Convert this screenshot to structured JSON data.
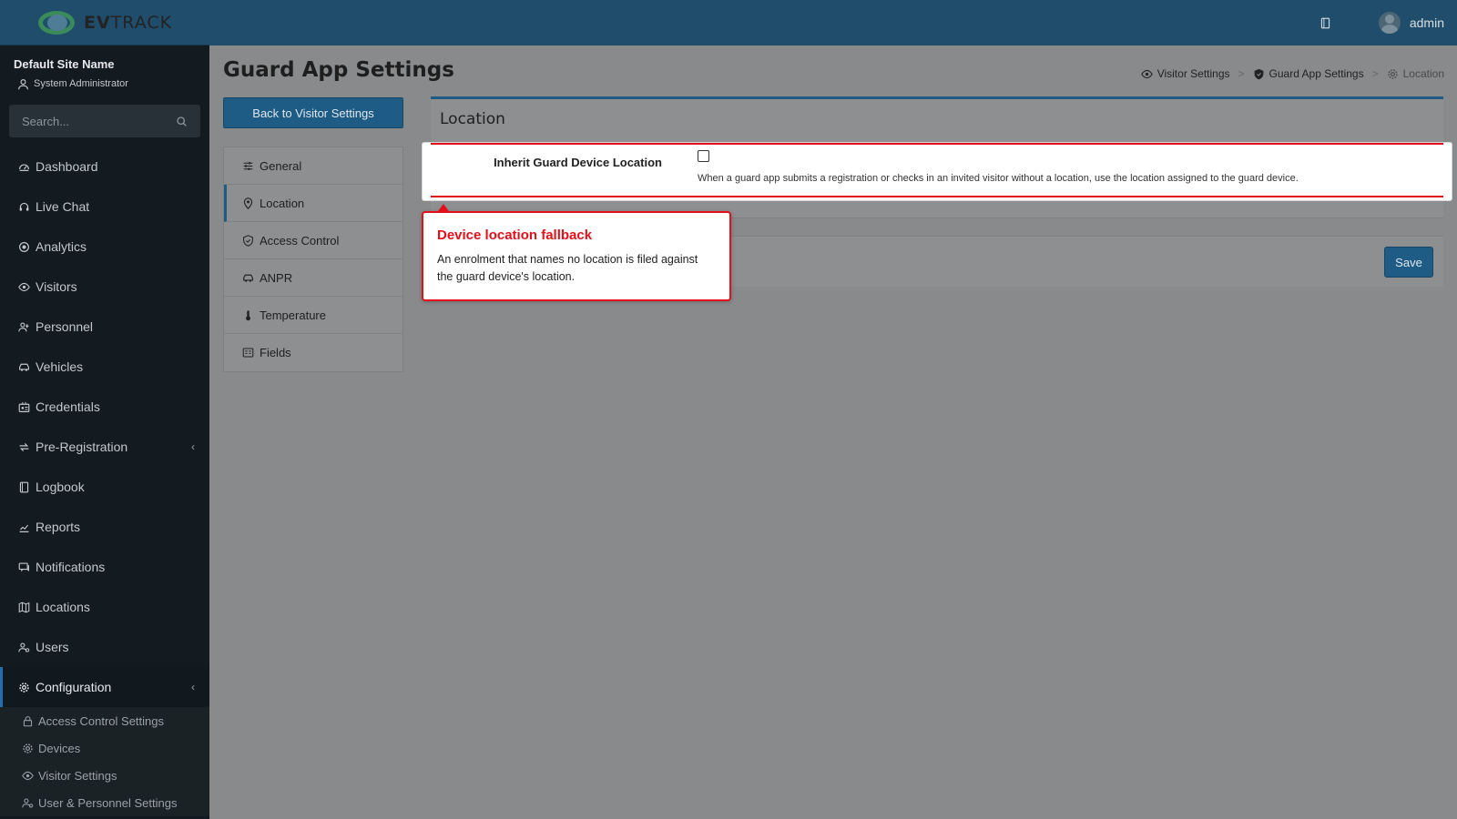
{
  "app": {
    "brand_bold": "EV",
    "brand_rest": "TRACK"
  },
  "sidebar": {
    "site_name": "Default Site Name",
    "site_role": "System Administrator",
    "search_placeholder": "Search...",
    "items": [
      {
        "label": "Dashboard",
        "icon": "dashboard-icon"
      },
      {
        "label": "Live Chat",
        "icon": "headset-icon"
      },
      {
        "label": "Analytics",
        "icon": "analytics-icon"
      },
      {
        "label": "Visitors",
        "icon": "eye-icon"
      },
      {
        "label": "Personnel",
        "icon": "personnel-icon"
      },
      {
        "label": "Vehicles",
        "icon": "car-icon"
      },
      {
        "label": "Credentials",
        "icon": "id-card-icon"
      },
      {
        "label": "Pre-Registration",
        "icon": "arrows-icon"
      },
      {
        "label": "Logbook",
        "icon": "book-icon"
      },
      {
        "label": "Reports",
        "icon": "reports-icon"
      },
      {
        "label": "Notifications",
        "icon": "chat-icon"
      },
      {
        "label": "Locations",
        "icon": "map-icon"
      },
      {
        "label": "Users",
        "icon": "users-icon"
      },
      {
        "label": "Configuration",
        "icon": "gear-icon"
      }
    ],
    "sub_items": [
      {
        "label": "Access Control Settings",
        "icon": "lock-icon"
      },
      {
        "label": "Devices",
        "icon": "gear-icon"
      },
      {
        "label": "Visitor Settings",
        "icon": "eye-icon"
      },
      {
        "label": "User & Personnel Settings",
        "icon": "users-icon"
      }
    ]
  },
  "topbar": {
    "username": "admin"
  },
  "page": {
    "title": "Guard App Settings",
    "back_label": "Back to Visitor Settings",
    "breadcrumb": [
      "Visitor Settings",
      "Guard App Settings",
      "Location"
    ],
    "tabs": [
      "General",
      "Location",
      "Access Control",
      "ANPR",
      "Temperature",
      "Fields"
    ]
  },
  "card": {
    "title": "Location",
    "field_label": "Inherit Guard Device Location",
    "field_help": "When a guard app submits a registration or checks in an invited visitor without a location, use the location assigned to the guard device.",
    "save_label": "Save"
  },
  "callout": {
    "title": "Device location fallback",
    "body": "An enrolment that names no location is filed against the guard device's location."
  },
  "colors": {
    "accent": "#1f5c85",
    "callout": "#e3101b",
    "sidebar": "#141b20"
  }
}
